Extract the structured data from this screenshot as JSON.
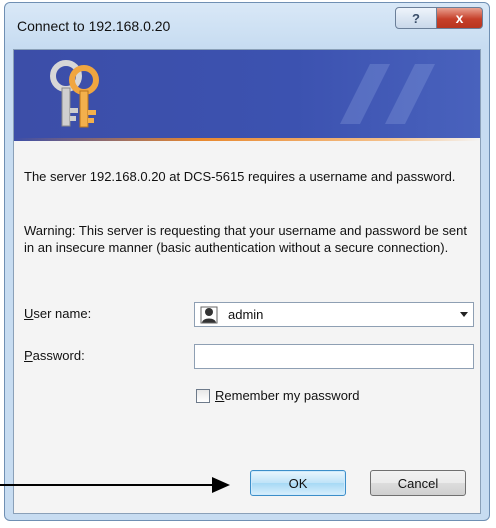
{
  "window": {
    "title": "Connect to 192.168.0.20",
    "help_button": "?",
    "close_button": "x"
  },
  "dialog": {
    "message": "The server 192.168.0.20 at DCS-5615 requires a username and password.",
    "warning": "Warning: This server is requesting that your username and password be sent in an insecure manner (basic authentication without a secure connection).",
    "username_label_accel": "U",
    "username_label_rest": "ser name:",
    "username_value": "admin",
    "password_label_accel": "P",
    "password_label_rest": "assword:",
    "password_value": "",
    "remember_label_accel": "R",
    "remember_label_rest": "emember my password",
    "remember_checked": false,
    "ok_label": "OK",
    "cancel_label": "Cancel"
  },
  "icons": {
    "banner": "keys-icon",
    "user": "user-account-icon",
    "combo": "chevron-down-icon"
  },
  "colors": {
    "banner": "#3c4ea8",
    "accent_line": "#e8882e",
    "close_button": "#c6402a"
  }
}
